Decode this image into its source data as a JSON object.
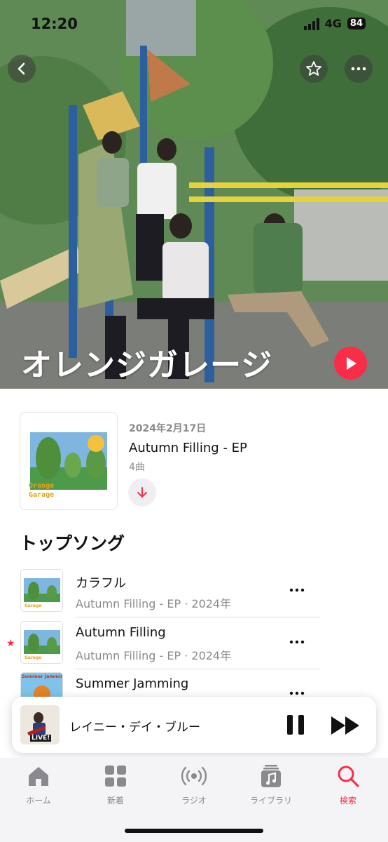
{
  "status": {
    "time": "12:20",
    "network": "4G",
    "battery": "84"
  },
  "hero": {
    "artist_name": "オレンジガレージ"
  },
  "icons": {
    "back": "chevron-left-icon",
    "star": "star-icon",
    "more": "ellipsis-icon",
    "play": "play-icon",
    "download": "arrow-down-icon"
  },
  "latest_release": {
    "date": "2024年2月17日",
    "title": "Autumn Filling - EP",
    "track_count": "4曲",
    "art_text": "Orange Garage"
  },
  "top_songs": {
    "title": "トップソング",
    "songs": [
      {
        "title": "カラフル",
        "subtitle": "Autumn Filling - EP · 2024年",
        "art_text": "Garage",
        "favorite": false
      },
      {
        "title": "Autumn Filling",
        "subtitle": "Autumn Filling - EP · 2024年",
        "art_text": "Garage",
        "favorite": true
      },
      {
        "title": "Summer Jamming",
        "subtitle": "",
        "art_text": "Summer Jamming",
        "favorite": false
      }
    ]
  },
  "mini_player": {
    "title": "レイニー・デイ・ブルー",
    "art_text": "LIVE!"
  },
  "tabs": [
    {
      "label": "ホーム",
      "icon": "home-icon",
      "active": false
    },
    {
      "label": "新着",
      "icon": "grid-icon",
      "active": false
    },
    {
      "label": "ラジオ",
      "icon": "radio-icon",
      "active": false
    },
    {
      "label": "ライブラリ",
      "icon": "music-library-icon",
      "active": false
    },
    {
      "label": "検索",
      "icon": "search-icon",
      "active": true
    }
  ],
  "colors": {
    "accent": "#fa2d48",
    "secondary_text": "#8a8a8e"
  }
}
